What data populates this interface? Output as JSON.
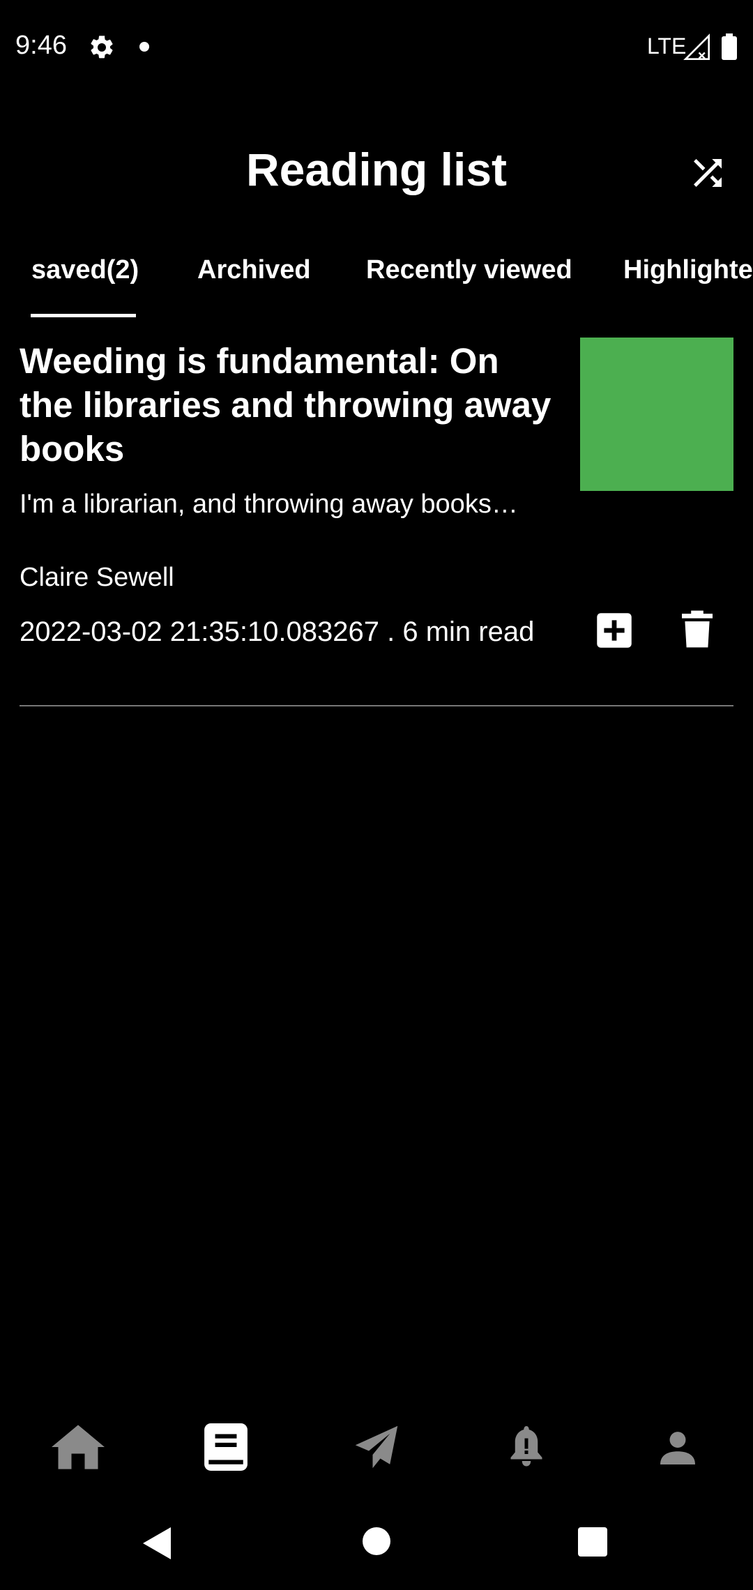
{
  "status_bar": {
    "time": "9:46",
    "network": "LTE",
    "icons": [
      "gear-icon",
      "notification-dot",
      "signal-icon",
      "battery-icon"
    ]
  },
  "header": {
    "title": "Reading list",
    "action_icon": "shuffle-icon"
  },
  "tabs": [
    {
      "label": "saved(2)",
      "selected": true
    },
    {
      "label": "Archived",
      "selected": false
    },
    {
      "label": "Recently viewed",
      "selected": false
    },
    {
      "label": "Highlighted",
      "selected": false
    }
  ],
  "articles": [
    {
      "title": "Weeding is fundamental: On the libraries and throwing away books",
      "excerpt": "I'm a librarian, and throwing away books…",
      "author": "Claire Sewell",
      "meta": "2022-03-02 21:35:10.083267 . 6 min read",
      "thumbnail_color": "#4caf50",
      "actions": [
        "plus-square-icon",
        "trash-icon"
      ]
    }
  ],
  "bottom_nav": [
    {
      "icon": "home-icon",
      "active": false
    },
    {
      "icon": "book-icon",
      "active": true
    },
    {
      "icon": "send-icon",
      "active": false
    },
    {
      "icon": "bell-icon",
      "active": false
    },
    {
      "icon": "person-icon",
      "active": false
    }
  ],
  "colors": {
    "background": "#000000",
    "text": "#ffffff",
    "inactive_icon": "#8a8a8a",
    "thumbnail": "#4caf50"
  }
}
